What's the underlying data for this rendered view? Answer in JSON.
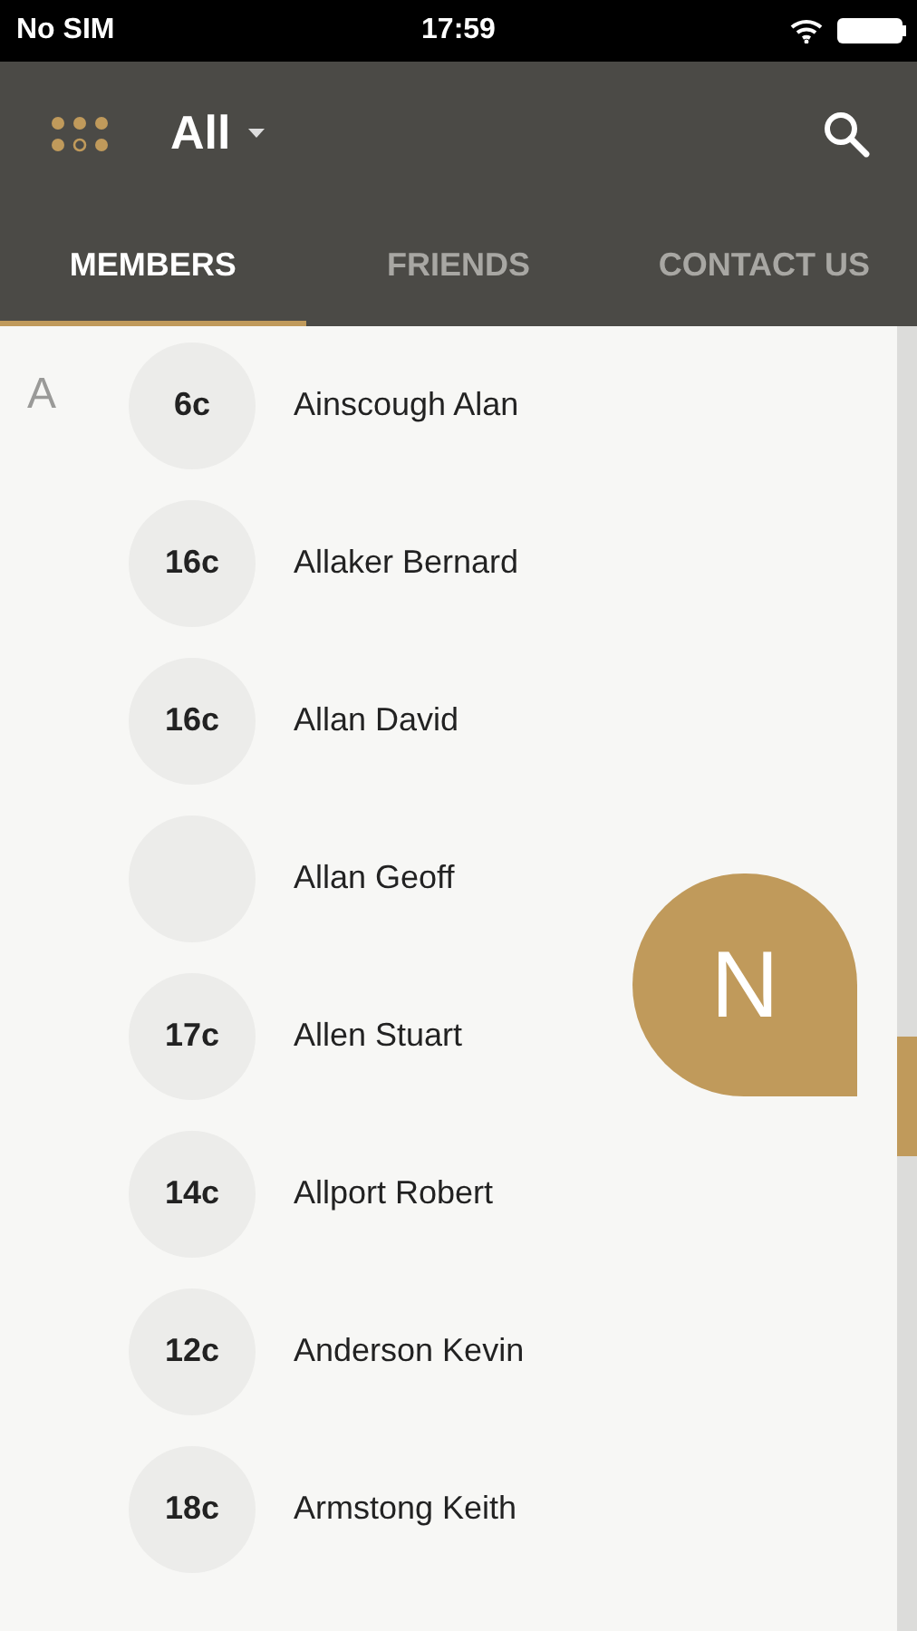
{
  "status_bar": {
    "carrier": "No SIM",
    "time": "17:59"
  },
  "app_bar": {
    "filter": "All"
  },
  "tabs": [
    {
      "label": "MEMBERS",
      "selected": true
    },
    {
      "label": "FRIENDS",
      "selected": false
    },
    {
      "label": "CONTACT US",
      "selected": false
    }
  ],
  "section": "A",
  "members": [
    {
      "badge": "6c",
      "name": "Ainscough Alan"
    },
    {
      "badge": "16c",
      "name": "Allaker Bernard"
    },
    {
      "badge": "16c",
      "name": "Allan David"
    },
    {
      "name": "Allan Geoff"
    },
    {
      "badge": "17c",
      "name": "Allen Stuart"
    },
    {
      "badge": "14c",
      "name": "Allport Robert"
    },
    {
      "badge": "12c",
      "name": "Anderson Kevin"
    },
    {
      "badge": "18c",
      "name": "Armstong Keith"
    }
  ],
  "scroll_index": {
    "letter": "N"
  }
}
